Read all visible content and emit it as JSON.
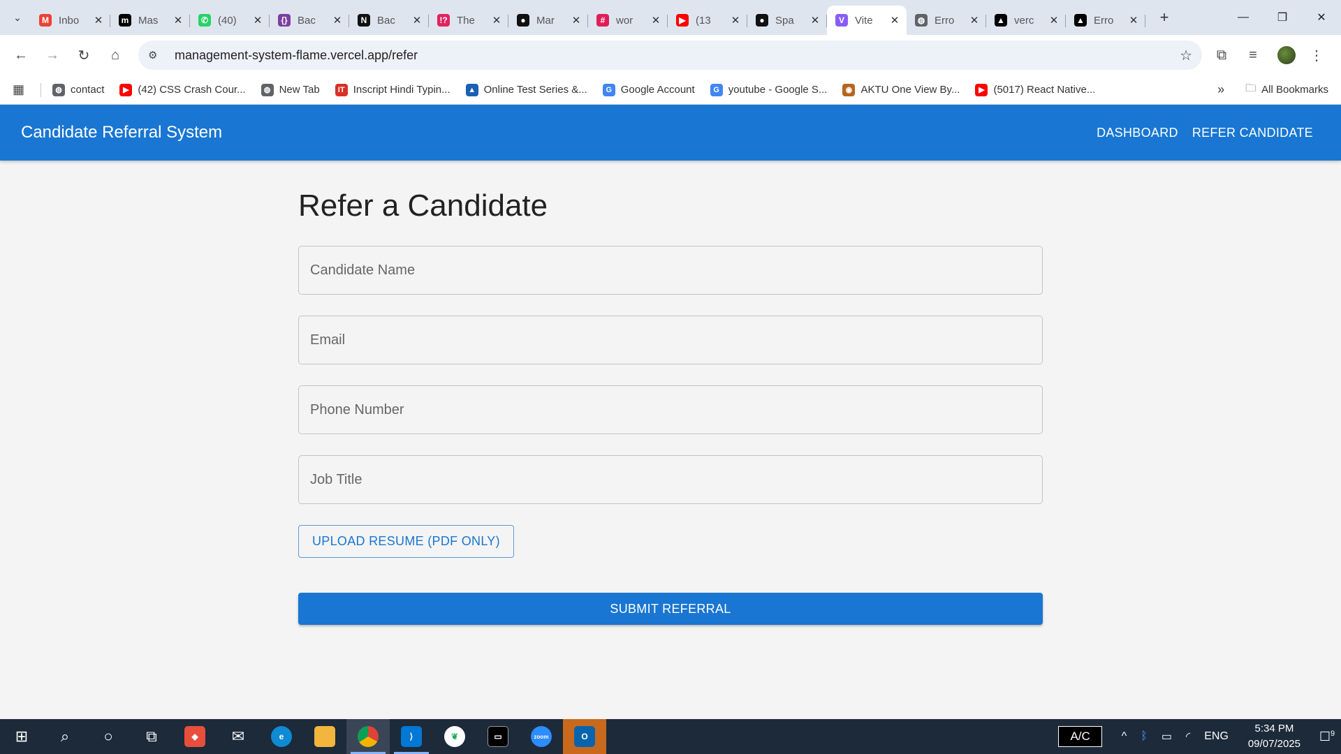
{
  "browser": {
    "tabs": [
      {
        "title": "Inbo",
        "icon": "gmail-icon",
        "color": "#ea4335",
        "glyph": "M"
      },
      {
        "title": "Mas",
        "icon": "medium-icon",
        "color": "#000000",
        "glyph": "m"
      },
      {
        "title": "(40)",
        "icon": "whatsapp-icon",
        "color": "#25d366",
        "glyph": "✆"
      },
      {
        "title": "Bac",
        "icon": "code-icon",
        "color": "#7b3fa0",
        "glyph": "{}"
      },
      {
        "title": "Bac",
        "icon": "notion-icon",
        "color": "#111111",
        "glyph": "N"
      },
      {
        "title": "The",
        "icon": "question-icon",
        "color": "#e0245e",
        "glyph": "!?"
      },
      {
        "title": "Mar",
        "icon": "github-icon",
        "color": "#111111",
        "glyph": "●"
      },
      {
        "title": "wor",
        "icon": "slack-icon",
        "color": "#e01e5a",
        "glyph": "#"
      },
      {
        "title": "(13",
        "icon": "youtube-icon",
        "color": "#ff0000",
        "glyph": "▶"
      },
      {
        "title": "Spa",
        "icon": "github-icon",
        "color": "#111111",
        "glyph": "●"
      },
      {
        "title": "Vite",
        "icon": "vite-icon",
        "color": "#8a5cf6",
        "glyph": "V",
        "active": true
      },
      {
        "title": "Erro",
        "icon": "globe-icon",
        "color": "#5f6368",
        "glyph": "◍"
      },
      {
        "title": "verc",
        "icon": "vercel-icon",
        "color": "#000000",
        "glyph": "▲"
      },
      {
        "title": "Erro",
        "icon": "vercel-icon",
        "color": "#000000",
        "glyph": "▲"
      }
    ],
    "url": "management-system-flame.vercel.app/refer",
    "bookmarks": [
      {
        "label": "contact",
        "icon": "globe-icon",
        "color": "#5f6368",
        "glyph": "◍"
      },
      {
        "label": "(42) CSS Crash Cour...",
        "icon": "youtube-icon",
        "color": "#ff0000",
        "glyph": "▶"
      },
      {
        "label": "New Tab",
        "icon": "globe-icon",
        "color": "#5f6368",
        "glyph": "◍"
      },
      {
        "label": "Inscript Hindi Typin...",
        "icon": "it-icon",
        "color": "#d93025",
        "glyph": "IT"
      },
      {
        "label": "Online Test Series &...",
        "icon": "book-icon",
        "color": "#1a5fb4",
        "glyph": "▲"
      },
      {
        "label": "Google Account",
        "icon": "google-icon",
        "color": "#4285f4",
        "glyph": "G"
      },
      {
        "label": "youtube - Google S...",
        "icon": "google-icon",
        "color": "#4285f4",
        "glyph": "G"
      },
      {
        "label": "AKTU One View By...",
        "icon": "aktu-icon",
        "color": "#b5651d",
        "glyph": "◉"
      },
      {
        "label": "(5017) React Native...",
        "icon": "youtube-icon",
        "color": "#ff0000",
        "glyph": "▶"
      }
    ],
    "all_bookmarks": "All Bookmarks"
  },
  "app": {
    "brand": "Candidate Referral System",
    "nav": {
      "dashboard": "DASHBOARD",
      "refer": "REFER CANDIDATE"
    },
    "page_title": "Refer a Candidate",
    "fields": {
      "name_placeholder": "Candidate Name",
      "email_placeholder": "Email",
      "phone_placeholder": "Phone Number",
      "job_placeholder": "Job Title"
    },
    "upload_label": "UPLOAD RESUME (PDF ONLY)",
    "submit_label": "SUBMIT REFERRAL",
    "accent_color": "#1976d2"
  },
  "taskbar": {
    "ac_label": "A/C",
    "language": "ENG",
    "time": "5:34 PM",
    "date": "09/07/2025",
    "notification_count": "9"
  }
}
